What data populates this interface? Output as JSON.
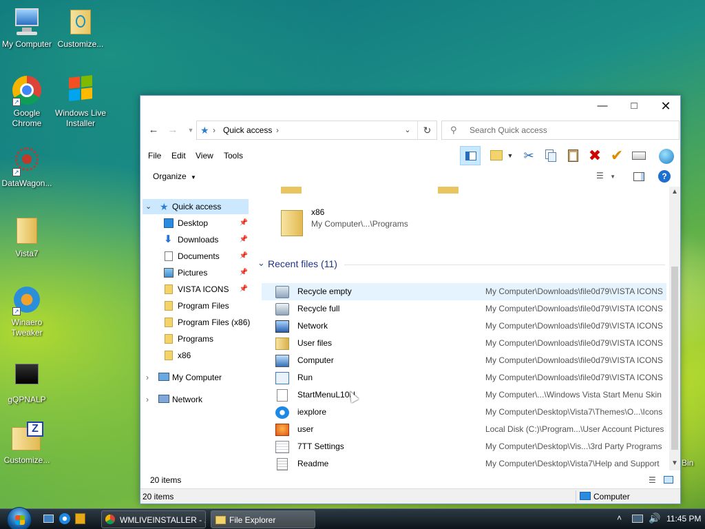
{
  "desktop": {
    "icons": [
      {
        "label": "My Computer"
      },
      {
        "label": "Customize..."
      },
      {
        "label": "Google Chrome"
      },
      {
        "label": "Windows Live Installer"
      },
      {
        "label": "DataWagon..."
      },
      {
        "label": "Vista7"
      },
      {
        "label": "Winaero Tweaker"
      },
      {
        "label": "gQPNALP"
      },
      {
        "label": "Customize..."
      }
    ],
    "bin_partial_label": "Bin"
  },
  "window": {
    "address": {
      "root": "Quick access"
    },
    "search_placeholder": "Search Quick access",
    "menu": [
      "File",
      "Edit",
      "View",
      "Tools"
    ],
    "organize_label": "Organize",
    "nav": {
      "quick_access": "Quick access",
      "pinned": [
        {
          "label": "Desktop"
        },
        {
          "label": "Downloads"
        },
        {
          "label": "Documents"
        },
        {
          "label": "Pictures"
        },
        {
          "label": "VISTA ICONS"
        }
      ],
      "recent": [
        {
          "label": "Program Files"
        },
        {
          "label": "Program Files (x86)"
        },
        {
          "label": "Programs"
        },
        {
          "label": "x86"
        }
      ],
      "my_computer": "My Computer",
      "network": "Network"
    },
    "frequent_item": {
      "name": "x86",
      "path": "My Computer\\...\\Programs"
    },
    "recent_header": "Recent files (11)",
    "recent_files": [
      {
        "name": "Recycle empty",
        "path": "My Computer\\Downloads\\file0d79\\VISTA ICONS"
      },
      {
        "name": "Recycle full",
        "path": "My Computer\\Downloads\\file0d79\\VISTA ICONS"
      },
      {
        "name": "Network",
        "path": "My Computer\\Downloads\\file0d79\\VISTA ICONS"
      },
      {
        "name": "User files",
        "path": "My Computer\\Downloads\\file0d79\\VISTA ICONS"
      },
      {
        "name": "Computer",
        "path": "My Computer\\Downloads\\file0d79\\VISTA ICONS"
      },
      {
        "name": "Run",
        "path": "My Computer\\Downloads\\file0d79\\VISTA ICONS"
      },
      {
        "name": "StartMenuL10N",
        "path": "My Computer\\...\\Windows Vista Start Menu Skin"
      },
      {
        "name": "iexplore",
        "path": "My Computer\\Desktop\\Vista7\\Themes\\O...\\Icons"
      },
      {
        "name": "user",
        "path": "Local Disk (C:)\\Program...\\User Account Pictures"
      },
      {
        "name": "7TT Settings",
        "path": "My Computer\\Desktop\\Vis...\\3rd Party Programs"
      },
      {
        "name": "Readme",
        "path": "My Computer\\Desktop\\Vista7\\Help and Support"
      }
    ],
    "status_items": "20 items",
    "status_items_bottom": "20 items",
    "status_location": "Computer"
  },
  "taskbar": {
    "tasks": [
      "WMLIVEINSTALLER - ...",
      "File Explorer"
    ],
    "clock": "11:45 PM"
  },
  "colors": {
    "accent": "#0078d7",
    "selection": "#cce8ff",
    "hover": "#e5f3ff",
    "delete_red": "#d00000",
    "check_orange": "#e08a00"
  }
}
